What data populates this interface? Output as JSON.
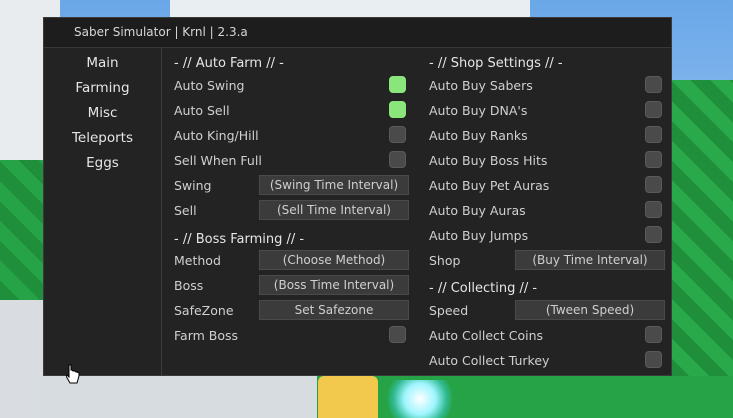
{
  "window": {
    "title": "Saber Simulator | Krnl | 2.3.a"
  },
  "tabs": [
    "Main",
    "Farming",
    "Misc",
    "Teleports",
    "Eggs"
  ],
  "left_column": {
    "auto_farm": {
      "header": "- // Auto Farm // -",
      "auto_swing": {
        "label": "Auto Swing",
        "on": true
      },
      "auto_sell": {
        "label": "Auto Sell",
        "on": true
      },
      "auto_king_hill": {
        "label": "Auto King/Hill",
        "on": false
      },
      "sell_when_full": {
        "label": "Sell When Full",
        "on": false
      },
      "swing": {
        "label": "Swing",
        "placeholder": "(Swing Time Interval)"
      },
      "sell": {
        "label": "Sell",
        "placeholder": "(Sell Time Interval)"
      }
    },
    "boss_farming": {
      "header": "- // Boss Farming // -",
      "method": {
        "label": "Method",
        "value": "(Choose Method)"
      },
      "boss": {
        "label": "Boss",
        "placeholder": "(Boss Time Interval)"
      },
      "safezone": {
        "label": "SafeZone",
        "button": "Set Safezone"
      },
      "farm_boss": {
        "label": "Farm Boss",
        "on": false
      }
    }
  },
  "right_column": {
    "shop_settings": {
      "header": "- // Shop Settings // -",
      "auto_buy_sabers": {
        "label": "Auto Buy Sabers",
        "on": false
      },
      "auto_buy_dna": {
        "label": "Auto Buy DNA's",
        "on": false
      },
      "auto_buy_ranks": {
        "label": "Auto Buy Ranks",
        "on": false
      },
      "auto_buy_boss_hits": {
        "label": "Auto Buy Boss Hits",
        "on": false
      },
      "auto_buy_pet_auras": {
        "label": "Auto Buy Pet Auras",
        "on": false
      },
      "auto_buy_auras": {
        "label": "Auto Buy Auras",
        "on": false
      },
      "auto_buy_jumps": {
        "label": "Auto Buy Jumps",
        "on": false
      },
      "shop": {
        "label": "Shop",
        "placeholder": "(Buy Time Interval)"
      }
    },
    "collecting": {
      "header": "- // Collecting // -",
      "speed": {
        "label": "Speed",
        "placeholder": "(Tween Speed)"
      },
      "auto_collect_coins": {
        "label": "Auto Collect Coins",
        "on": false
      },
      "auto_collect_turkey": {
        "label": "Auto Collect Turkey",
        "on": false
      }
    }
  },
  "colors": {
    "toggle_on": "#8ae57a",
    "toggle_off": "#4a4a4a",
    "panel_bg": "#232323"
  }
}
